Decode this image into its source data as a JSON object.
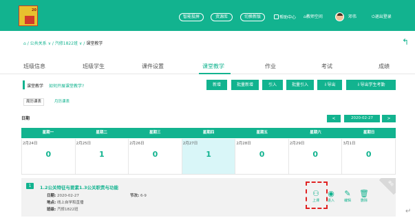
{
  "topbar": {
    "pills": [
      "智能投屏",
      "资源库",
      "切换新版"
    ],
    "help": "帮助中心",
    "teacher_space": "教师空间",
    "user_name": "邓伟",
    "logout": "退出登录",
    "bg_color": "#12b38f"
  },
  "breadcrumb": {
    "home_icon": "home-icon",
    "path": "/ 公共关系 ∨ / 汽修1822班 ∨ / ",
    "current": "课堂教学",
    "back_icon": "back-arrow-icon"
  },
  "tabs": [
    "班级信息",
    "班级学生",
    "课件设置",
    "课堂教学",
    "作业",
    "考试",
    "成绩"
  ],
  "active_tab": "课堂教学",
  "toolbar": {
    "title": "课堂教学",
    "link": "如何开展课堂教学?",
    "buttons": [
      "新增",
      "批量新增",
      "引入",
      "批量引入",
      "导出",
      "导出学生考勤"
    ]
  },
  "subtabs": [
    "周历课表",
    "月历课表"
  ],
  "calendar": {
    "label": "日期",
    "prev": "<",
    "next": ">",
    "current_date": "2020-02-27",
    "weekdays": [
      "星期一",
      "星期二",
      "星期三",
      "星期四",
      "星期五",
      "星期六",
      "星期日"
    ],
    "dates": [
      "2月24日",
      "2月25日",
      "2月26日",
      "2月27日",
      "2月28日",
      "2月29日",
      "3月1日"
    ],
    "counts": [
      "0",
      "1",
      "0",
      "1",
      "0",
      "0",
      "0"
    ],
    "today_index": 3
  },
  "course": {
    "number": "1",
    "title": "1.2公关特征与要素1.3公关职责与功能",
    "date_label": "日期:",
    "date_value": "2020-02-27",
    "place_label": "地点:",
    "place_value": "线上自学和直播",
    "class_label": "班级:",
    "class_value": "汽修1822班",
    "period_label": "节次:",
    "period_value": "6-9",
    "actions": [
      "上课",
      "进入",
      "编辑",
      "删除"
    ],
    "ribbon": "课后"
  }
}
